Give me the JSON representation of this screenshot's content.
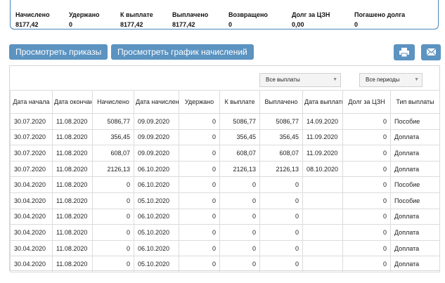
{
  "summary": [
    {
      "label": "Начислено",
      "value": "8177,42"
    },
    {
      "label": "Удержано",
      "value": "0"
    },
    {
      "label": "К выплате",
      "value": "8177,42"
    },
    {
      "label": "Выплачено",
      "value": "8177,42"
    },
    {
      "label": "Возвращено",
      "value": "0"
    },
    {
      "label": "Долг за ЦЗН",
      "value": "0,00"
    },
    {
      "label": "Погашено долга",
      "value": "0"
    }
  ],
  "buttons": {
    "orders": "Просмотреть приказы",
    "schedule": "Просмотреть график начислений",
    "print_icon": "printer-icon",
    "mail_icon": "envelope-icon"
  },
  "filters": {
    "payments": "Все выплаты",
    "periods": "Все периоды"
  },
  "table": {
    "headers": [
      "Дата начала",
      "Дата окончания",
      "Начислено",
      "Дата начисления",
      "Удержано",
      "К выплате",
      "Выплачено",
      "Дата выплаты",
      "Долг за ЦЗН",
      "Тип выплаты"
    ],
    "rows": [
      [
        "30.07.2020",
        "11.08.2020",
        "5086,77",
        "09.09.2020",
        "0",
        "5086,77",
        "5086,77",
        "14.09.2020",
        "0",
        "Пособие"
      ],
      [
        "30.07.2020",
        "11.08.2020",
        "356,45",
        "09.09.2020",
        "0",
        "356,45",
        "356,45",
        "11.09.2020",
        "0",
        "Доплата"
      ],
      [
        "30.07.2020",
        "11.08.2020",
        "608,07",
        "09.09.2020",
        "0",
        "608,07",
        "608,07",
        "11.09.2020",
        "0",
        "Доплата"
      ],
      [
        "30.07.2020",
        "11.08.2020",
        "2126,13",
        "06.10.2020",
        "0",
        "2126,13",
        "2126,13",
        "08.10.2020",
        "0",
        "Доплата"
      ],
      [
        "30.04.2020",
        "11.08.2020",
        "0",
        "06.10.2020",
        "0",
        "0",
        "0",
        "",
        "0",
        "Пособие"
      ],
      [
        "30.04.2020",
        "11.08.2020",
        "0",
        "05.10.2020",
        "0",
        "0",
        "0",
        "",
        "0",
        "Пособие"
      ],
      [
        "30.04.2020",
        "11.08.2020",
        "0",
        "06.10.2020",
        "0",
        "0",
        "0",
        "",
        "0",
        "Доплата"
      ],
      [
        "30.04.2020",
        "11.08.2020",
        "0",
        "05.10.2020",
        "0",
        "0",
        "0",
        "",
        "0",
        "Доплата"
      ],
      [
        "30.04.2020",
        "11.08.2020",
        "0",
        "06.10.2020",
        "0",
        "0",
        "0",
        "",
        "0",
        "Доплата"
      ],
      [
        "30.04.2020",
        "11.08.2020",
        "0",
        "05.10.2020",
        "0",
        "0",
        "0",
        "",
        "0",
        "Доплата"
      ]
    ]
  },
  "colors": {
    "accent": "#5b93c1",
    "border": "#4a86b8"
  }
}
